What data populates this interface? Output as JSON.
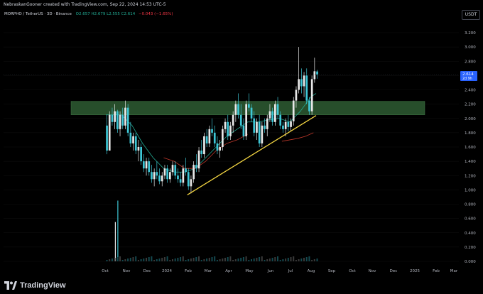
{
  "header": {
    "credit": "NebraskanGooner created with TradingView.com, Sep 22, 2024 14:53 UTC-5",
    "currency": "USDT",
    "symbol": "MORPHO / TetherUS · 3D · Binance",
    "ohlc": "O2.657 H2.679 L2.555 C2.614",
    "change": "−0.043 (−1.65%)"
  },
  "price_label": {
    "value": "2.614",
    "sub": "2d 9h"
  },
  "footer": {
    "brand": "TradingView"
  },
  "colors": {
    "background": "#000000",
    "up": "#e8e8e8",
    "down": "#3ec7d6",
    "zone": "#2e5c33",
    "trendline": "#f5d742",
    "ma_green": "#22ab94",
    "ma_red": "#c0392b",
    "current_price": "#2962ff"
  },
  "chart_data": {
    "type": "candlestick",
    "title": "MORPHO / TetherUS · 3D · Binance",
    "ylim": [
      -0.1,
      3.35
    ],
    "y_ticks": [
      "3.200",
      "3.000",
      "2.800",
      "2.600",
      "2.400",
      "2.200",
      "2.000",
      "1.800",
      "1.600",
      "1.400",
      "1.200",
      "1.000",
      "0.800",
      "0.600",
      "0.400",
      "0.200",
      "0.000"
    ],
    "x_labels": [
      "Oct",
      "Nov",
      "Dec",
      "2024",
      "Feb",
      "Mar",
      "Apr",
      "May",
      "Jun",
      "Jul",
      "Aug",
      "Sep",
      "Oct",
      "Nov",
      "Dec",
      "2025",
      "Feb",
      "Mar"
    ],
    "current_price": 2.614,
    "zone": {
      "low": 2.05,
      "high": 2.24
    },
    "candles": [
      [
        1.9,
        2.05,
        1.5,
        1.55
      ],
      [
        1.55,
        2.1,
        1.55,
        2.05
      ],
      [
        2.05,
        2.15,
        1.9,
        1.95
      ],
      [
        1.95,
        2.2,
        1.85,
        2.1
      ],
      [
        2.1,
        2.12,
        1.8,
        1.85
      ],
      [
        1.85,
        2.1,
        1.75,
        2.05
      ],
      [
        2.05,
        2.15,
        1.85,
        1.9
      ],
      [
        1.9,
        2.25,
        1.85,
        2.15
      ],
      [
        2.15,
        2.2,
        1.75,
        1.8
      ],
      [
        1.8,
        1.95,
        1.6,
        1.65
      ],
      [
        1.65,
        1.8,
        1.55,
        1.75
      ],
      [
        1.75,
        1.8,
        1.5,
        1.55
      ],
      [
        1.55,
        1.7,
        1.4,
        1.6
      ],
      [
        1.6,
        1.65,
        1.35,
        1.4
      ],
      [
        1.4,
        1.5,
        1.25,
        1.3
      ],
      [
        1.3,
        1.45,
        1.2,
        1.4
      ],
      [
        1.4,
        1.45,
        1.2,
        1.25
      ],
      [
        1.25,
        1.35,
        1.1,
        1.15
      ],
      [
        1.15,
        1.3,
        1.05,
        1.25
      ],
      [
        1.25,
        1.4,
        1.15,
        1.2
      ],
      [
        1.2,
        1.3,
        1.08,
        1.12
      ],
      [
        1.12,
        1.25,
        1.05,
        1.2
      ],
      [
        1.2,
        1.35,
        1.15,
        1.3
      ],
      [
        1.3,
        1.35,
        1.1,
        1.15
      ],
      [
        1.15,
        1.3,
        1.1,
        1.25
      ],
      [
        1.25,
        1.4,
        1.2,
        1.35
      ],
      [
        1.35,
        1.4,
        1.15,
        1.2
      ],
      [
        1.2,
        1.3,
        1.1,
        1.15
      ],
      [
        1.15,
        1.25,
        1.05,
        1.1
      ],
      [
        1.1,
        1.35,
        1.05,
        1.3
      ],
      [
        1.3,
        1.45,
        1.2,
        1.25
      ],
      [
        1.25,
        1.3,
        1.0,
        1.05
      ],
      [
        1.05,
        1.2,
        0.95,
        1.15
      ],
      [
        1.15,
        1.4,
        1.1,
        1.35
      ],
      [
        1.35,
        1.5,
        1.25,
        1.3
      ],
      [
        1.3,
        1.6,
        1.25,
        1.55
      ],
      [
        1.55,
        1.7,
        1.45,
        1.5
      ],
      [
        1.5,
        1.8,
        1.45,
        1.75
      ],
      [
        1.75,
        1.85,
        1.6,
        1.65
      ],
      [
        1.65,
        1.9,
        1.6,
        1.85
      ],
      [
        1.85,
        2.0,
        1.75,
        1.8
      ],
      [
        1.8,
        1.9,
        1.6,
        1.65
      ],
      [
        1.65,
        1.75,
        1.5,
        1.55
      ],
      [
        1.55,
        1.7,
        1.45,
        1.6
      ],
      [
        1.6,
        1.9,
        1.55,
        1.85
      ],
      [
        1.85,
        2.0,
        1.8,
        1.95
      ],
      [
        1.95,
        2.05,
        1.7,
        1.75
      ],
      [
        1.75,
        1.95,
        1.7,
        1.9
      ],
      [
        1.9,
        2.1,
        1.8,
        2.05
      ],
      [
        2.05,
        2.25,
        1.95,
        2.2
      ],
      [
        2.2,
        2.35,
        2.0,
        2.05
      ],
      [
        2.05,
        2.2,
        1.85,
        1.9
      ],
      [
        1.9,
        2.0,
        1.7,
        1.75
      ],
      [
        1.75,
        2.25,
        1.7,
        2.2
      ],
      [
        2.2,
        2.35,
        2.1,
        2.15
      ],
      [
        2.15,
        2.2,
        1.95,
        2.0
      ],
      [
        2.0,
        2.1,
        1.75,
        1.8
      ],
      [
        1.8,
        2.0,
        1.7,
        1.95
      ],
      [
        1.95,
        2.05,
        1.6,
        1.65
      ],
      [
        1.65,
        1.95,
        1.6,
        1.9
      ],
      [
        1.9,
        2.0,
        1.8,
        1.85
      ],
      [
        1.85,
        2.05,
        1.75,
        2.0
      ],
      [
        2.0,
        2.2,
        1.95,
        2.1
      ],
      [
        2.1,
        2.15,
        1.9,
        1.95
      ],
      [
        1.95,
        2.25,
        1.9,
        2.2
      ],
      [
        2.2,
        2.3,
        2.0,
        2.05
      ],
      [
        2.05,
        2.1,
        1.85,
        1.9
      ],
      [
        1.9,
        1.95,
        1.8,
        1.85
      ],
      [
        1.85,
        2.0,
        1.75,
        1.95
      ],
      [
        1.95,
        2.05,
        1.82,
        1.88
      ],
      [
        1.88,
        2.0,
        1.82,
        1.96
      ],
      [
        1.96,
        2.3,
        1.9,
        2.25
      ],
      [
        2.25,
        2.45,
        2.15,
        2.4
      ],
      [
        2.4,
        3.0,
        2.35,
        2.55
      ],
      [
        2.55,
        2.7,
        2.35,
        2.45
      ],
      [
        2.45,
        2.65,
        2.3,
        2.6
      ],
      [
        2.6,
        2.7,
        2.2,
        2.25
      ],
      [
        2.25,
        2.3,
        2.05,
        2.1
      ],
      [
        2.1,
        2.6,
        2.05,
        2.55
      ],
      [
        2.55,
        2.85,
        2.5,
        2.66
      ],
      [
        2.657,
        2.679,
        2.555,
        2.614
      ]
    ],
    "ma_green": [
      [
        0,
        2.05
      ],
      [
        6,
        2.05
      ],
      [
        10,
        1.9
      ],
      [
        14,
        1.65
      ],
      [
        18,
        1.45
      ],
      [
        22,
        1.3
      ],
      [
        26,
        1.25
      ],
      [
        30,
        1.25
      ],
      [
        34,
        1.3
      ],
      [
        38,
        1.45
      ],
      [
        42,
        1.6
      ],
      [
        46,
        1.75
      ],
      [
        50,
        1.85
      ],
      [
        54,
        1.95
      ],
      [
        58,
        1.95
      ],
      [
        62,
        1.98
      ],
      [
        66,
        2.0
      ],
      [
        70,
        1.95
      ],
      [
        74,
        2.1
      ],
      [
        78,
        2.3
      ],
      [
        80,
        2.35
      ]
    ],
    "ma_red": [
      [
        22,
        1.45
      ],
      [
        26,
        1.4
      ],
      [
        30,
        1.3
      ],
      [
        34,
        1.3
      ],
      [
        38,
        1.4
      ],
      [
        42,
        1.55
      ],
      [
        46,
        1.65
      ],
      [
        50,
        1.7
      ],
      [
        54,
        1.78
      ]
    ],
    "ma_red2": [
      [
        67,
        1.68
      ],
      [
        70,
        1.7
      ],
      [
        73,
        1.72
      ],
      [
        76,
        1.75
      ],
      [
        79,
        1.8
      ]
    ],
    "trendline": {
      "from": [
        31,
        0.93
      ],
      "to": [
        80,
        2.04
      ]
    },
    "volume_spike": {
      "index": 4,
      "value": 0.85
    }
  }
}
